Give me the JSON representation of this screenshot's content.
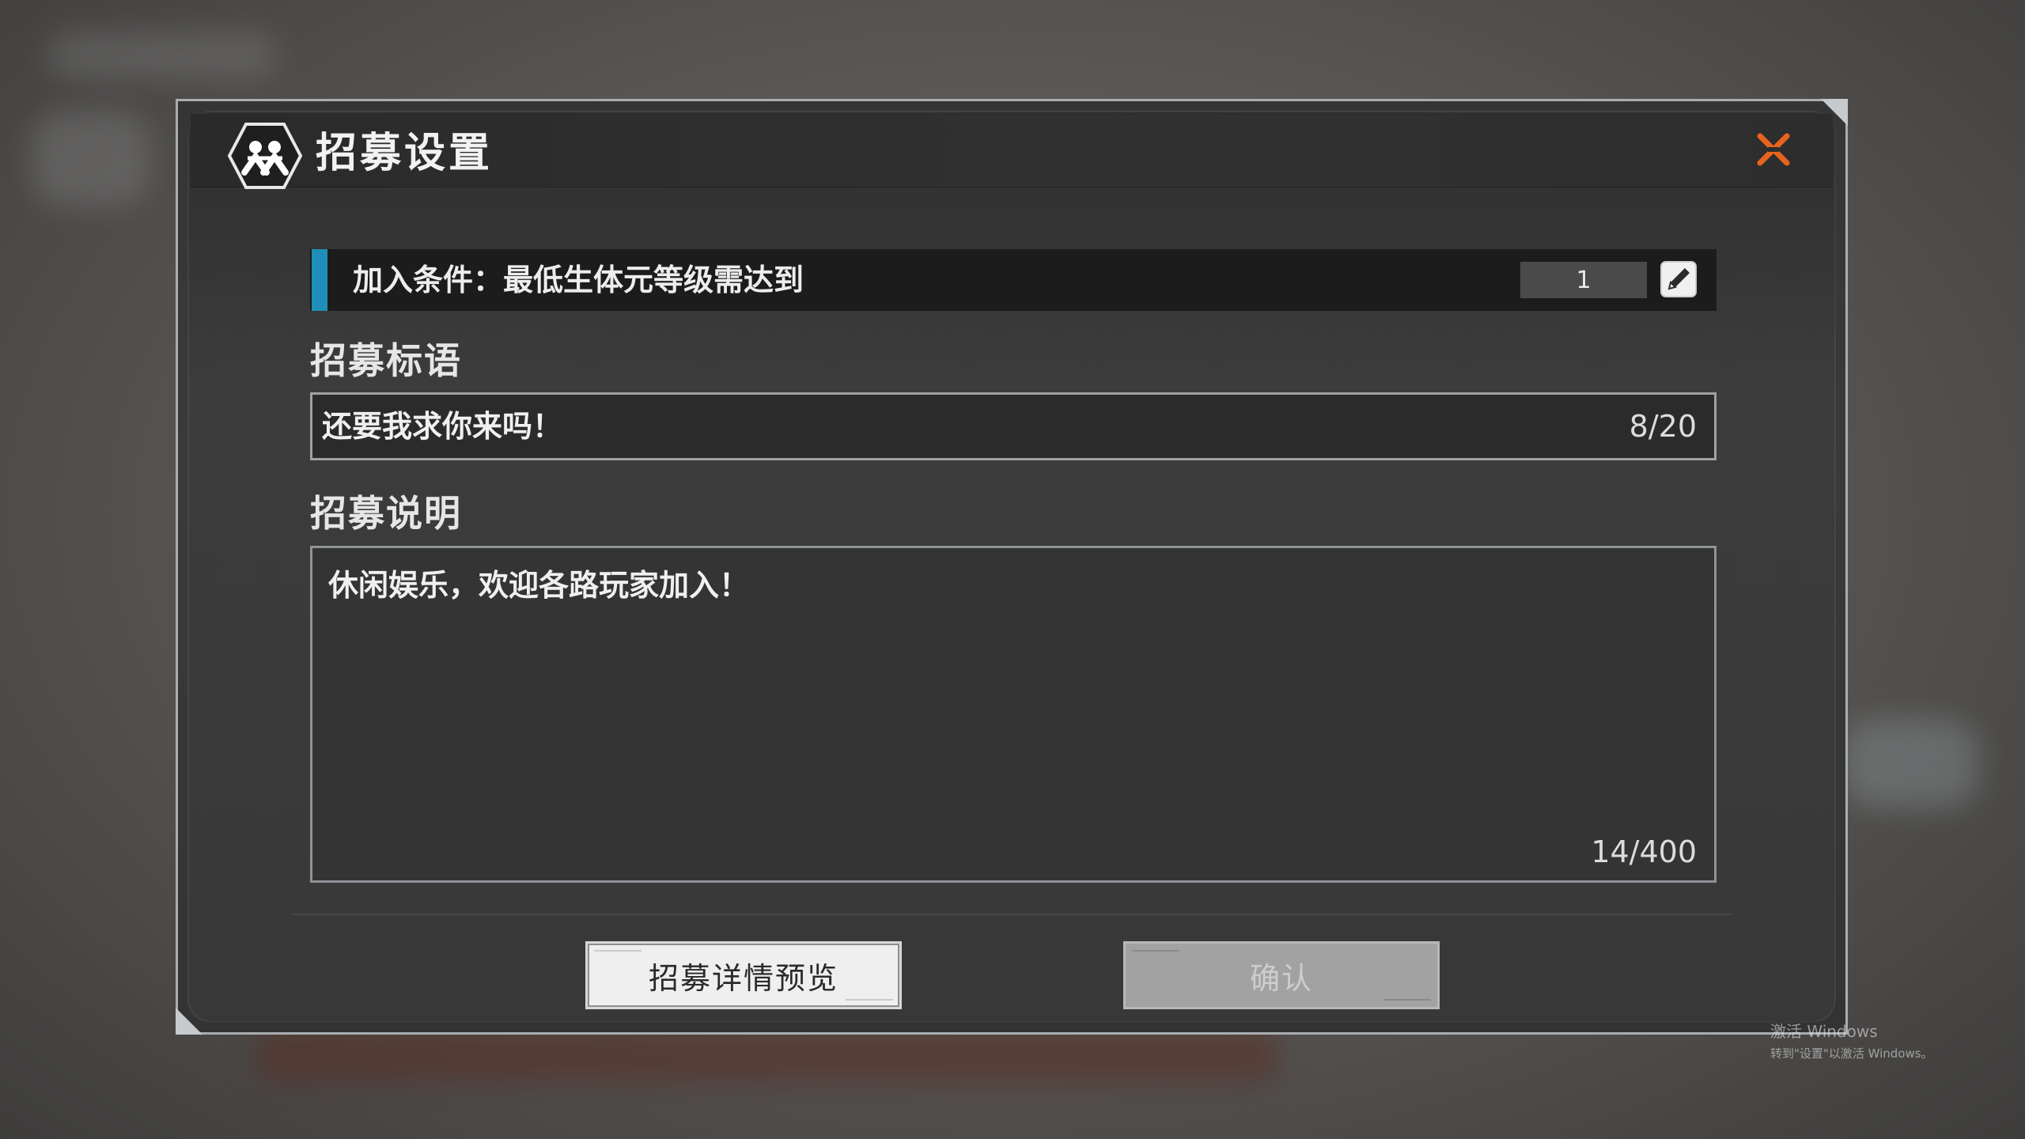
{
  "dialog": {
    "title": "招募设置",
    "close_icon": "close-x-icon",
    "emblem_icon": "guild-emblem-icon"
  },
  "condition": {
    "label": "加入条件：最低生体元等级需达到",
    "level_value": "1",
    "edit_icon": "pencil-edit-icon",
    "accent_color": "#1e8fb8"
  },
  "slogan": {
    "section_title": "招募标语",
    "value": "还要我求你来吗！",
    "counter": "8/20"
  },
  "description": {
    "section_title": "招募说明",
    "value": "休闲娱乐，欢迎各路玩家加入！",
    "counter": "14/400"
  },
  "buttons": {
    "preview_label": "招募详情预览",
    "confirm_label": "确认"
  },
  "watermark": {
    "line1": "激活 Windows",
    "line2": "转到\"设置\"以激活 Windows。"
  },
  "colors": {
    "close_icon": "#e8641e",
    "accent": "#1e8fb8"
  }
}
